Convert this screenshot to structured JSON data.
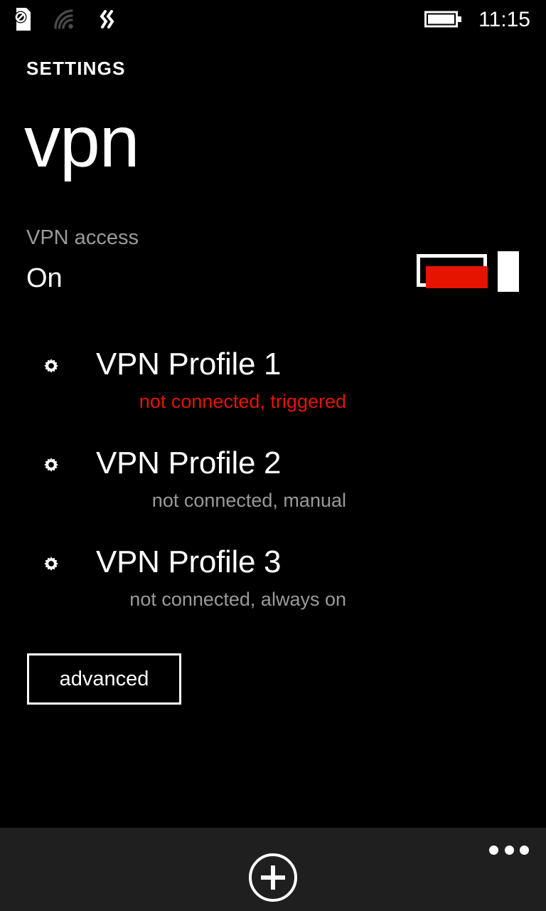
{
  "status_bar": {
    "icons": [
      {
        "name": "sim-missing-icon",
        "label": "no SIM"
      },
      {
        "name": "wifi-icon",
        "label": "wifi unavailable"
      },
      {
        "name": "vibrate-icon",
        "label": "vibrate"
      }
    ],
    "battery": {
      "name": "battery-icon",
      "label": "battery full"
    },
    "clock": "11:15"
  },
  "header": {
    "app_title": "SETTINGS",
    "page_title": "vpn"
  },
  "vpn_access": {
    "label": "VPN access",
    "value": "On",
    "toggle_state": "on",
    "toggle_color": "#e51400"
  },
  "profiles": [
    {
      "name": "VPN Profile 1",
      "status": "not connected, triggered",
      "status_color": "#e51400",
      "alert": true
    },
    {
      "name": "VPN Profile 2",
      "status": "not connected, manual",
      "status_color": "#9a9a9a",
      "alert": false
    },
    {
      "name": "VPN Profile 3",
      "status": "not connected, always on",
      "status_color": "#9a9a9a",
      "alert": false
    }
  ],
  "advanced_button": {
    "label": "advanced"
  },
  "app_bar": {
    "add_label": "add",
    "more_label": "more"
  },
  "theme": {
    "background": "#000000",
    "accent": "#e51400",
    "subtle_text": "#9a9a9a",
    "appbar_background": "#1f1f1f"
  }
}
